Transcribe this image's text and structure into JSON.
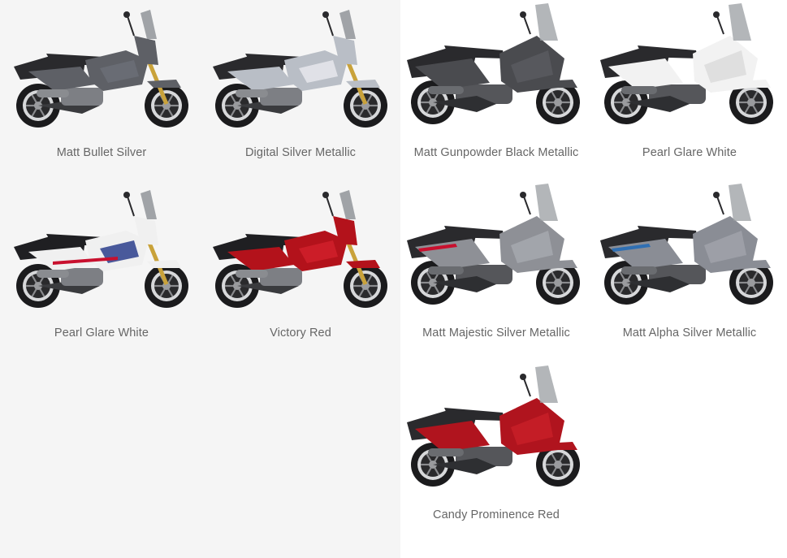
{
  "groups": [
    {
      "name": "adventure-scooter",
      "items": [
        {
          "label": "Matt Bullet Silver",
          "style": "adventure",
          "body": "#5e6066",
          "accent": "#6b6f77",
          "seat": "#2a2a2d"
        },
        {
          "label": "Digital Silver Metallic",
          "style": "adventure",
          "body": "#b9bec6",
          "accent": "#e6e8ec",
          "seat": "#2a2a2d"
        },
        {
          "label": "Pearl Glare White",
          "style": "adventure",
          "body": "#f0f0f0",
          "accent": "#2b3e8c",
          "seat": "#1f1f22",
          "stripe": "#c8102e"
        },
        {
          "label": "Victory Red",
          "style": "adventure",
          "body": "#b3121b",
          "accent": "#d0202a",
          "seat": "#1f1f22"
        }
      ]
    },
    {
      "name": "touring-scooter",
      "items": [
        {
          "label": "Matt Gunpowder Black Metallic",
          "style": "touring",
          "body": "#4a4b4f",
          "accent": "#5a5b60",
          "seat": "#2a2a2d"
        },
        {
          "label": "Pearl Glare White",
          "style": "touring",
          "body": "#f2f2f2",
          "accent": "#d9d9d9",
          "seat": "#2a2a2d"
        },
        {
          "label": "Matt Majestic Silver Metallic",
          "style": "touring",
          "body": "#8e9096",
          "accent": "#a8aab0",
          "seat": "#2a2a2d",
          "stripe": "#c8102e"
        },
        {
          "label": "Matt Alpha Silver Metallic",
          "style": "touring",
          "body": "#8a8d95",
          "accent": "#a1a4ab",
          "seat": "#2a2a2d",
          "stripe": "#2f6fb3"
        },
        {
          "label": "Candy Prominence Red",
          "style": "touring",
          "body": "#b0141e",
          "accent": "#c91f28",
          "seat": "#2a2a2d"
        }
      ]
    }
  ]
}
